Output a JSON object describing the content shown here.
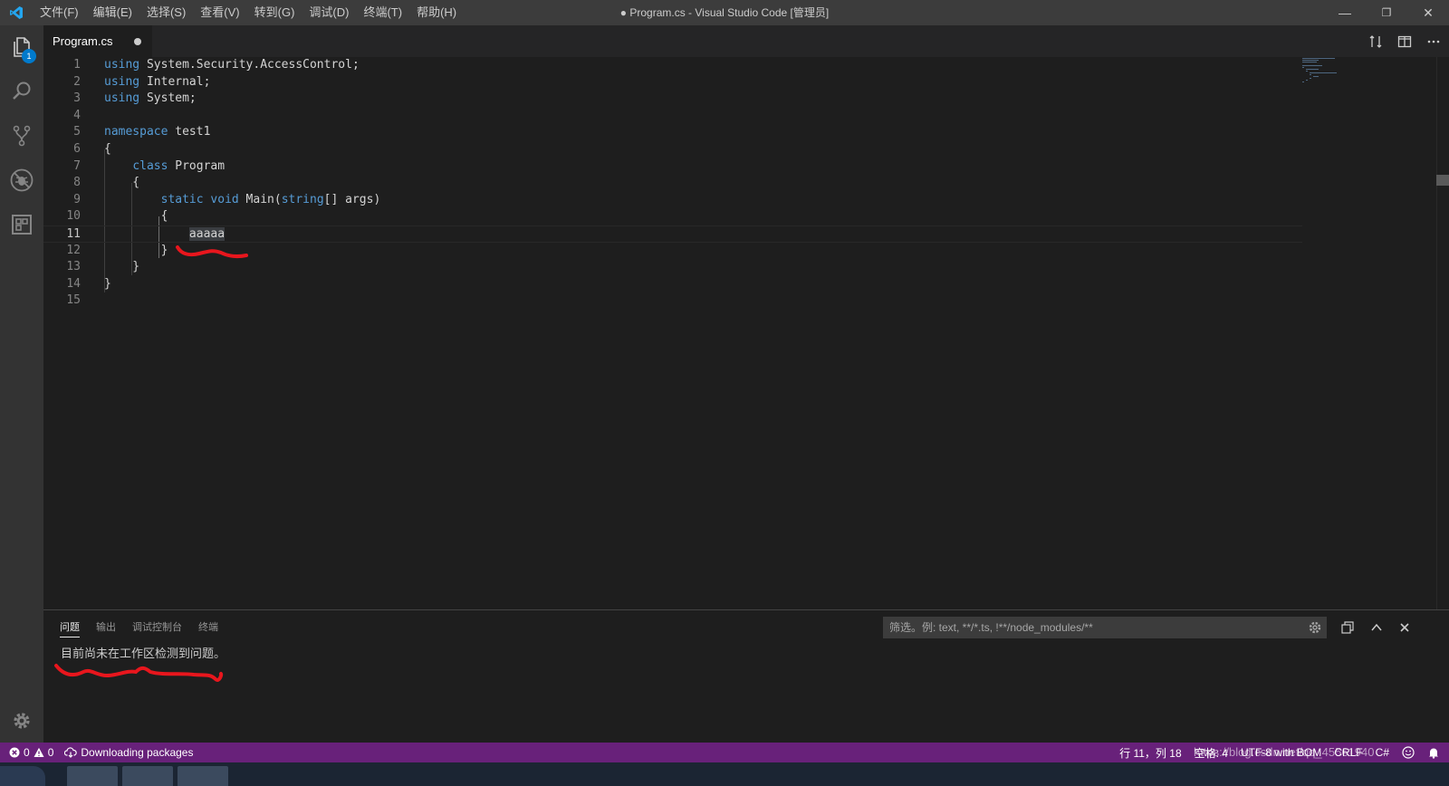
{
  "window": {
    "title": "● Program.cs - Visual Studio Code [管理员]",
    "menu": [
      "文件(F)",
      "编辑(E)",
      "选择(S)",
      "查看(V)",
      "转到(G)",
      "调试(D)",
      "终端(T)",
      "帮助(H)"
    ],
    "controls": {
      "minimize": "—",
      "restore": "❐",
      "close": "✕"
    }
  },
  "activitybar": {
    "items": [
      "explorer-icon",
      "search-icon",
      "source-control-icon",
      "debug-icon",
      "extensions-icon"
    ],
    "explorer_badge": "1",
    "bottom": "settings-gear-icon"
  },
  "tab": {
    "label": "Program.cs",
    "dirty": true
  },
  "editor": {
    "line_numbers": [
      "1",
      "2",
      "3",
      "4",
      "5",
      "6",
      "7",
      "8",
      "9",
      "10",
      "11",
      "12",
      "13",
      "14",
      "15"
    ],
    "current_line": 11,
    "lines": [
      [
        [
          "kw",
          "using"
        ],
        [
          "t",
          " System.Security.AccessControl;"
        ]
      ],
      [
        [
          "kw",
          "using"
        ],
        [
          "t",
          " Internal;"
        ]
      ],
      [
        [
          "kw",
          "using"
        ],
        [
          "t",
          " System;"
        ]
      ],
      [],
      [
        [
          "kw",
          "namespace"
        ],
        [
          "t",
          " test1"
        ]
      ],
      [
        [
          "t",
          "{"
        ]
      ],
      [
        [
          "t",
          "    "
        ],
        [
          "kw",
          "class"
        ],
        [
          "t",
          " Program"
        ]
      ],
      [
        [
          "t",
          "    {"
        ]
      ],
      [
        [
          "t",
          "        "
        ],
        [
          "kw",
          "static"
        ],
        [
          "t",
          " "
        ],
        [
          "kw",
          "void"
        ],
        [
          "t",
          " Main("
        ],
        [
          "kw",
          "string"
        ],
        [
          "t",
          "[] args)"
        ]
      ],
      [
        [
          "t",
          "        {"
        ]
      ],
      [
        [
          "t",
          "            "
        ],
        [
          "sel",
          "aaaaa"
        ]
      ],
      [
        [
          "t",
          "        }"
        ]
      ],
      [
        [
          "t",
          "    }"
        ]
      ],
      [
        [
          "t",
          "}"
        ]
      ],
      []
    ]
  },
  "panel": {
    "tabs": [
      "问题",
      "输出",
      "调试控制台",
      "终端"
    ],
    "active_tab": "问题",
    "filter_placeholder": "筛选。例: text, **/*.ts, !**/node_modules/**",
    "message": "目前尚未在工作区检测到问题。"
  },
  "statusbar": {
    "errors": "0",
    "warnings": "0",
    "task": "Downloading packages",
    "position": "行 11，列 18",
    "spaces": "空格: 4",
    "encoding": "UTF-8 with BOM",
    "eol": "CRLF",
    "language": "C#",
    "watermark": "https://blog.csdn.net/qq_45561940"
  },
  "colors": {
    "statusbar": "#68217a",
    "keyword": "#569cd6",
    "annotation": "#e8161d"
  }
}
